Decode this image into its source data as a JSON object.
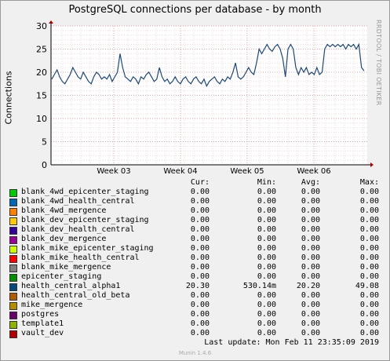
{
  "chart_data": {
    "type": "line",
    "title": "PostgreSQL connections per database - by month",
    "ylabel": "Connections",
    "side_label": "RRDTOOL / TOBI OETIKER",
    "ylim": [
      0,
      30
    ],
    "yticks": [
      0,
      5,
      10,
      15,
      20,
      25,
      30
    ],
    "xticks": [
      "Week 03",
      "Week 04",
      "Week 05",
      "Week 06"
    ],
    "grid": true,
    "series": [
      {
        "name": "health_central_alpha1",
        "color": "#1a4a7a",
        "values": [
          18.5,
          19.5,
          20.5,
          19,
          18,
          17.5,
          18.5,
          19.5,
          21,
          20,
          19,
          18.5,
          20,
          19,
          18,
          17.5,
          19,
          20,
          19.5,
          18.5,
          19,
          18.5,
          19.5,
          18,
          19,
          20,
          24,
          21,
          19,
          18.5,
          18,
          19,
          18.5,
          17.5,
          19,
          18.5,
          19.5,
          20,
          19,
          18,
          18.5,
          21,
          19,
          18,
          18.5,
          17.5,
          18,
          19,
          18,
          17.5,
          18.5,
          19,
          18,
          17.5,
          18.5,
          19,
          18,
          17.5,
          18.5,
          17,
          18,
          18.5,
          19,
          18,
          17.5,
          18.5,
          18,
          19,
          18.5,
          20,
          22,
          19,
          18.5,
          19,
          20,
          21,
          20,
          19.5,
          22,
          25,
          24,
          25,
          26,
          25,
          24.5,
          25.5,
          26,
          25,
          23,
          19,
          25,
          26,
          25,
          21,
          19.5,
          21,
          20,
          21,
          19.5,
          20,
          19.5,
          21,
          19.5,
          20,
          25,
          26,
          25.5,
          26,
          25.5,
          26,
          25.5,
          26,
          25,
          26,
          25.5,
          26,
          25,
          26,
          21,
          20.3
        ]
      }
    ]
  },
  "legend": {
    "headers": {
      "cur": "Cur:",
      "min": "Min:",
      "avg": "Avg:",
      "max": "Max:"
    },
    "rows": [
      {
        "name": "blank_4wd_epicenter_staging",
        "color": "#00cc00",
        "cur": "0.00",
        "min": "0.00",
        "avg": "0.00",
        "max": "0.00"
      },
      {
        "name": "blank_4wd_health_central",
        "color": "#0066b3",
        "cur": "0.00",
        "min": "0.00",
        "avg": "0.00",
        "max": "0.00"
      },
      {
        "name": "blank_4wd_mergence",
        "color": "#ff8000",
        "cur": "0.00",
        "min": "0.00",
        "avg": "0.00",
        "max": "0.00"
      },
      {
        "name": "blank_dev_epicenter_staging",
        "color": "#ffcc00",
        "cur": "0.00",
        "min": "0.00",
        "avg": "0.00",
        "max": "0.00"
      },
      {
        "name": "blank_dev_health_central",
        "color": "#330099",
        "cur": "0.00",
        "min": "0.00",
        "avg": "0.00",
        "max": "0.00"
      },
      {
        "name": "blank_dev_mergence",
        "color": "#990099",
        "cur": "0.00",
        "min": "0.00",
        "avg": "0.00",
        "max": "0.00"
      },
      {
        "name": "blank_mike_epicenter_staging",
        "color": "#ccff00",
        "cur": "0.00",
        "min": "0.00",
        "avg": "0.00",
        "max": "0.00"
      },
      {
        "name": "blank_mike_health_central",
        "color": "#ff0000",
        "cur": "0.00",
        "min": "0.00",
        "avg": "0.00",
        "max": "0.00"
      },
      {
        "name": "blank_mike_mergence",
        "color": "#808080",
        "cur": "0.00",
        "min": "0.00",
        "avg": "0.00",
        "max": "0.00"
      },
      {
        "name": "epicenter_staging",
        "color": "#008f00",
        "cur": "0.00",
        "min": "0.00",
        "avg": "0.00",
        "max": "0.00"
      },
      {
        "name": "health_central_alpha1",
        "color": "#00487d",
        "cur": "20.30",
        "min": "530.14m",
        "avg": "20.20",
        "max": "49.08"
      },
      {
        "name": "health_central_old_beta",
        "color": "#b35a00",
        "cur": "0.00",
        "min": "0.00",
        "avg": "0.00",
        "max": "0.00"
      },
      {
        "name": "mike_mergence",
        "color": "#b38f00",
        "cur": "0.00",
        "min": "0.00",
        "avg": "0.00",
        "max": "0.00"
      },
      {
        "name": "postgres",
        "color": "#6b006b",
        "cur": "0.00",
        "min": "0.00",
        "avg": "0.00",
        "max": "0.00"
      },
      {
        "name": "template1",
        "color": "#8fb300",
        "cur": "0.00",
        "min": "0.00",
        "avg": "0.00",
        "max": "0.00"
      },
      {
        "name": "vault_dev",
        "color": "#b30000",
        "cur": "0.00",
        "min": "0.00",
        "avg": "0.00",
        "max": "0.00"
      }
    ]
  },
  "footer": {
    "last_update": "Last update:  Mon Feb 11 23:35:09 2019",
    "munin": "Munin 1.4.6"
  }
}
